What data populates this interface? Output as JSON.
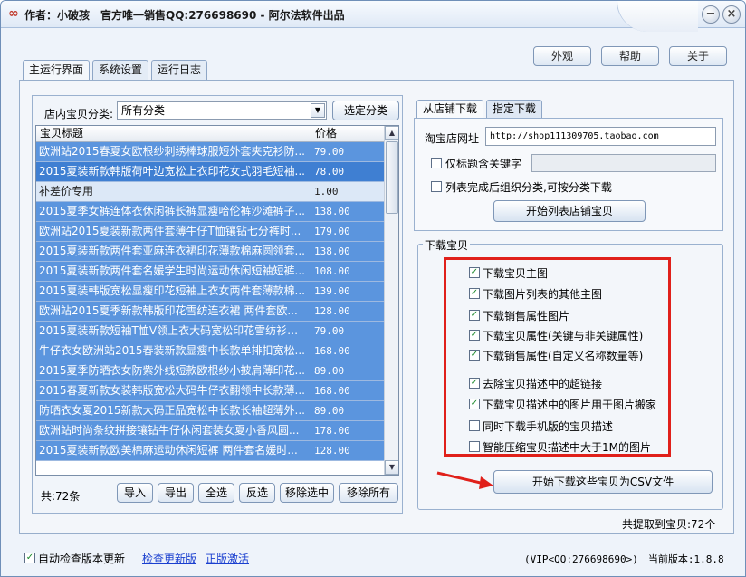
{
  "window": {
    "title": "作者：小破孩　官方唯一销售QQ:276698690 - 阿尔法软件出品"
  },
  "topbar": {
    "appearance": "外观",
    "help": "帮助",
    "about": "关于"
  },
  "main_tabs": [
    "主运行界面",
    "系统设置",
    "运行日志"
  ],
  "category": {
    "label": "店内宝贝分类:",
    "value": "所有分类",
    "button": "选定分类"
  },
  "list": {
    "headers": {
      "title": "宝贝标题",
      "price": "价格"
    },
    "rows": [
      {
        "title": "欧洲站2015春夏女欧根纱刺绣棒球服短外套夹克衫防...",
        "price": "79.00"
      },
      {
        "title": "2015夏装新款韩版荷叶边宽松上衣印花女式羽毛短袖...",
        "price": "78.00"
      },
      {
        "title": "补差价专用",
        "price": "1.00"
      },
      {
        "title": "2015夏季女裤连体衣休闲裤长裤显瘦哈伦裤沙滩裤子...",
        "price": "138.00"
      },
      {
        "title": "欧洲站2015夏装新款两件套薄牛仔T恤镶钻七分裤时...",
        "price": "179.00"
      },
      {
        "title": "2015夏装新款两件套亚麻连衣裙印花薄款棉麻圆领套...",
        "price": "138.00"
      },
      {
        "title": "2015夏装新款两件套名媛学生时尚运动休闲短袖短裤...",
        "price": "108.00"
      },
      {
        "title": "2015夏装韩版宽松显瘦印花短袖上衣女两件套薄款棉...",
        "price": "139.00"
      },
      {
        "title": "欧洲站2015夏季新款韩版印花雪纺连衣裙 两件套欧...",
        "price": "128.00"
      },
      {
        "title": "2015夏装新款短袖T恤V领上衣大码宽松印花雪纺衫小衫...",
        "price": "79.00"
      },
      {
        "title": "牛仔衣女欧洲站2015春装新款显瘦中长款单排扣宽松...",
        "price": "168.00"
      },
      {
        "title": "2015夏季防晒衣女防紫外线短款欧根纱小披肩薄印花...",
        "price": "89.00"
      },
      {
        "title": "2015春夏新款女装韩版宽松大码牛仔衣翻领中长款薄...",
        "price": "168.00"
      },
      {
        "title": "防晒衣女夏2015新款大码正品宽松中长款长袖超薄外...",
        "price": "89.00"
      },
      {
        "title": "欧洲站时尚条纹拼接镶钻牛仔休闲套装女夏小香风圆...",
        "price": "178.00"
      },
      {
        "title": "2015夏装新款欧美棉麻运动休闲短裤 两件套名媛时...",
        "price": "128.00"
      }
    ],
    "count": "共:72条"
  },
  "list_buttons": {
    "import": "导入",
    "export": "导出",
    "all": "全选",
    "invert": "反选",
    "remove_sel": "移除选中",
    "remove_all": "移除所有"
  },
  "sub_tabs": [
    "从店铺下载",
    "指定下载"
  ],
  "shop": {
    "url_label": "淘宝店网址",
    "url": "http://shop111309705.taobao.com",
    "title_kw_label": "仅标题含关键字",
    "group_label": "列表完成后组织分类,可按分类下载",
    "start_list_button": "开始列表店铺宝贝"
  },
  "download": {
    "legend": "下载宝贝",
    "options": [
      {
        "label": "下载宝贝主图",
        "checked": true
      },
      {
        "label": "下载图片列表的其他主图",
        "checked": true
      },
      {
        "label": "下载销售属性图片",
        "checked": true
      },
      {
        "label": "下载宝贝属性(关键与非关键属性)",
        "checked": true
      },
      {
        "label": "下载销售属性(自定义名称数量等)",
        "checked": true
      },
      {
        "label": "去除宝贝描述中的超链接",
        "checked": true
      },
      {
        "label": "下载宝贝描述中的图片用于图片搬家",
        "checked": true
      },
      {
        "label": "同时下载手机版的宝贝描述",
        "checked": false
      },
      {
        "label": "智能压缩宝贝描述中大于1M的图片",
        "checked": false
      }
    ],
    "start_button": "开始下载这些宝贝为CSV文件",
    "total": "共提取到宝贝:72个"
  },
  "status": {
    "auto_check": "自动检查版本更新",
    "auto_checked": true,
    "check_update_link": "检查更新版",
    "activate_link": "正版激活",
    "version_text": "(VIP<QQ:276698690>)　当前版本:1.8.8"
  },
  "colors": {
    "selected_row": "#5b95de",
    "highlight_box": "#e0201a"
  }
}
